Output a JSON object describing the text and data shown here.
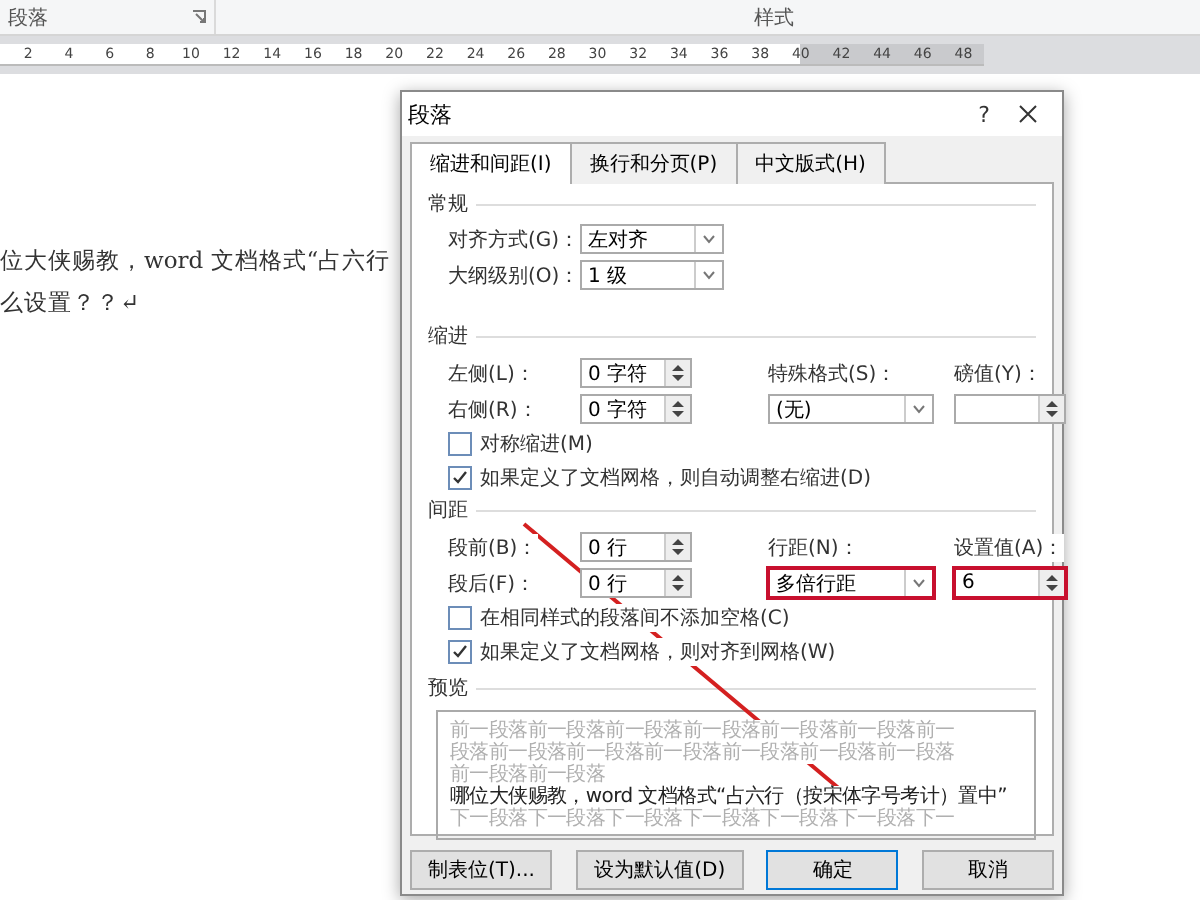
{
  "ribbon": {
    "groups": [
      {
        "label": "段落",
        "launcher": true
      },
      {
        "label": "样式",
        "launcher": false
      }
    ]
  },
  "ruler": {
    "ticks": [
      "2",
      "4",
      "6",
      "8",
      "10",
      "12",
      "14",
      "16",
      "18",
      "20",
      "22",
      "24",
      "26",
      "28",
      "30",
      "32",
      "34",
      "36",
      "38",
      "40",
      "42",
      "44",
      "46",
      "48"
    ]
  },
  "document": {
    "lines": [
      "位大侠赐教，word 文档格式“占六行",
      "么设置？？↵"
    ]
  },
  "dialog": {
    "title": "段落",
    "help": "?",
    "tabs": [
      {
        "label": "缩进和间距(I)",
        "selected": true
      },
      {
        "label": "换行和分页(P)",
        "selected": false
      },
      {
        "label": "中文版式(H)",
        "selected": false
      }
    ],
    "general": {
      "heading": "常规",
      "rows": [
        {
          "label": "对齐方式(G)：",
          "value": "左对齐"
        },
        {
          "label": "大纲级别(O)：",
          "value": "1 级"
        }
      ]
    },
    "indent": {
      "heading": "缩进",
      "rows": [
        [
          {
            "kind": "label",
            "text": "左侧(L)："
          },
          {
            "kind": "spin",
            "value": "0 字符",
            "highlighted": false
          },
          {
            "kind": "label",
            "text": "特殊格式(S)："
          },
          {
            "kind": "label",
            "text": "磅值(Y)："
          }
        ],
        [
          {
            "kind": "label",
            "text": "右侧(R)："
          },
          {
            "kind": "spin",
            "value": "0 字符",
            "highlighted": false
          },
          {
            "kind": "select",
            "value": "(无)",
            "highlighted": false
          },
          {
            "kind": "spin",
            "highlighted": false
          }
        ]
      ],
      "checks": [
        {
          "label": "对称缩进(M)",
          "checked": false
        },
        {
          "label": "如果定义了文档网格，则自动调整右缩进(D)",
          "checked": true
        }
      ]
    },
    "spacing": {
      "heading": "间距",
      "rows": [
        [
          {
            "kind": "label",
            "text": "段前(B)："
          },
          {
            "kind": "spin",
            "value": "0 行",
            "highlighted": false
          },
          {
            "kind": "label",
            "text": "行距(N)："
          },
          {
            "kind": "label",
            "text": "设置值(A)："
          }
        ],
        [
          {
            "kind": "label",
            "text": "段后(F)："
          },
          {
            "kind": "spin",
            "value": "0 行",
            "highlighted": false
          },
          {
            "kind": "select",
            "value": "多倍行距",
            "highlighted": true
          },
          {
            "kind": "spin",
            "value": "6",
            "highlighted": true
          }
        ]
      ],
      "checks": [
        {
          "label": "在相同样式的段落间不添加空格(C)",
          "checked": false
        },
        {
          "label": "如果定义了文档网格，则对齐到网格(W)",
          "checked": true
        }
      ]
    },
    "preview": {
      "heading": "预览",
      "before": [
        "前一段落前一段落前一段落前一段落前一段落前一段落前一",
        "段落前一段落前一段落前一段落前一段落前一段落前一段落",
        "前一段落前一段落"
      ],
      "current": "哪位大侠赐教，word 文档格式“占六行（按宋体字号考计）置中”",
      "after": [
        "下一段落下一段落下一段落下一段落下一段落下一段落下一"
      ]
    },
    "buttons": [
      {
        "label": "制表位(T)...",
        "default": false
      },
      {
        "label": "设为默认值(D)",
        "default": false
      },
      {
        "label": "确定",
        "default": true
      },
      {
        "label": "取消",
        "default": false
      }
    ]
  }
}
